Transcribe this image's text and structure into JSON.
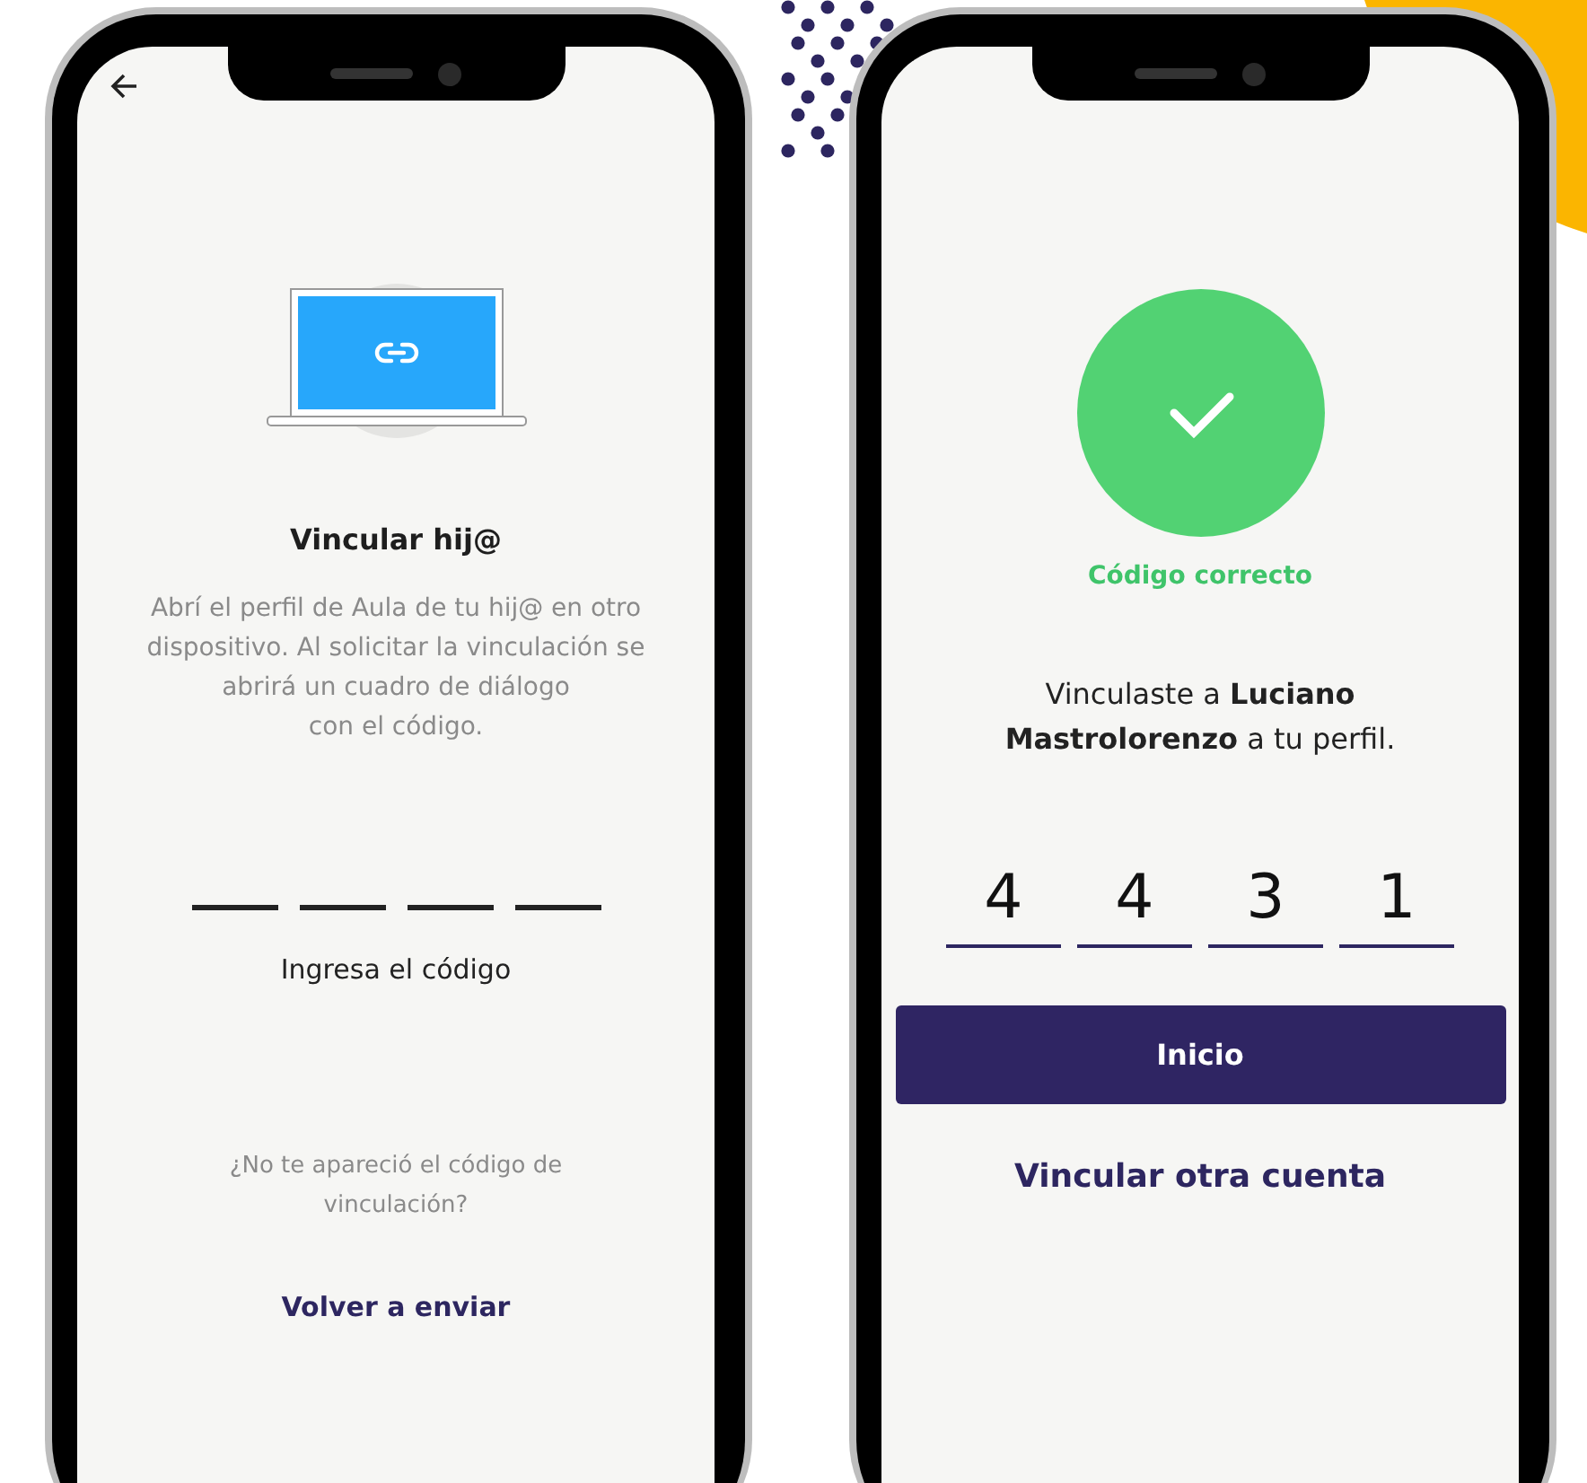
{
  "left_screen": {
    "title": "Vincular hij@",
    "description_lines": [
      "Abrí el perfil de Aula de tu hij@ en otro",
      "dispositivo. Al solicitar la vinculación se",
      "abrirá un cuadro de diálogo",
      "con el código."
    ],
    "code_label": "Ingresa el código",
    "hint_lines": [
      "¿No te apareció el código de",
      "vinculación?"
    ],
    "resend_link": "Volver a enviar"
  },
  "right_screen": {
    "status": "Código correcto",
    "message_lines": [
      "Vinculaste a **Luciano**",
      "**Mastrolorenzo** a tu perfil."
    ],
    "code": [
      "4",
      "4",
      "3",
      "1"
    ],
    "primary_button": "Inicio",
    "secondary_link": "Vincular otra cuenta"
  }
}
